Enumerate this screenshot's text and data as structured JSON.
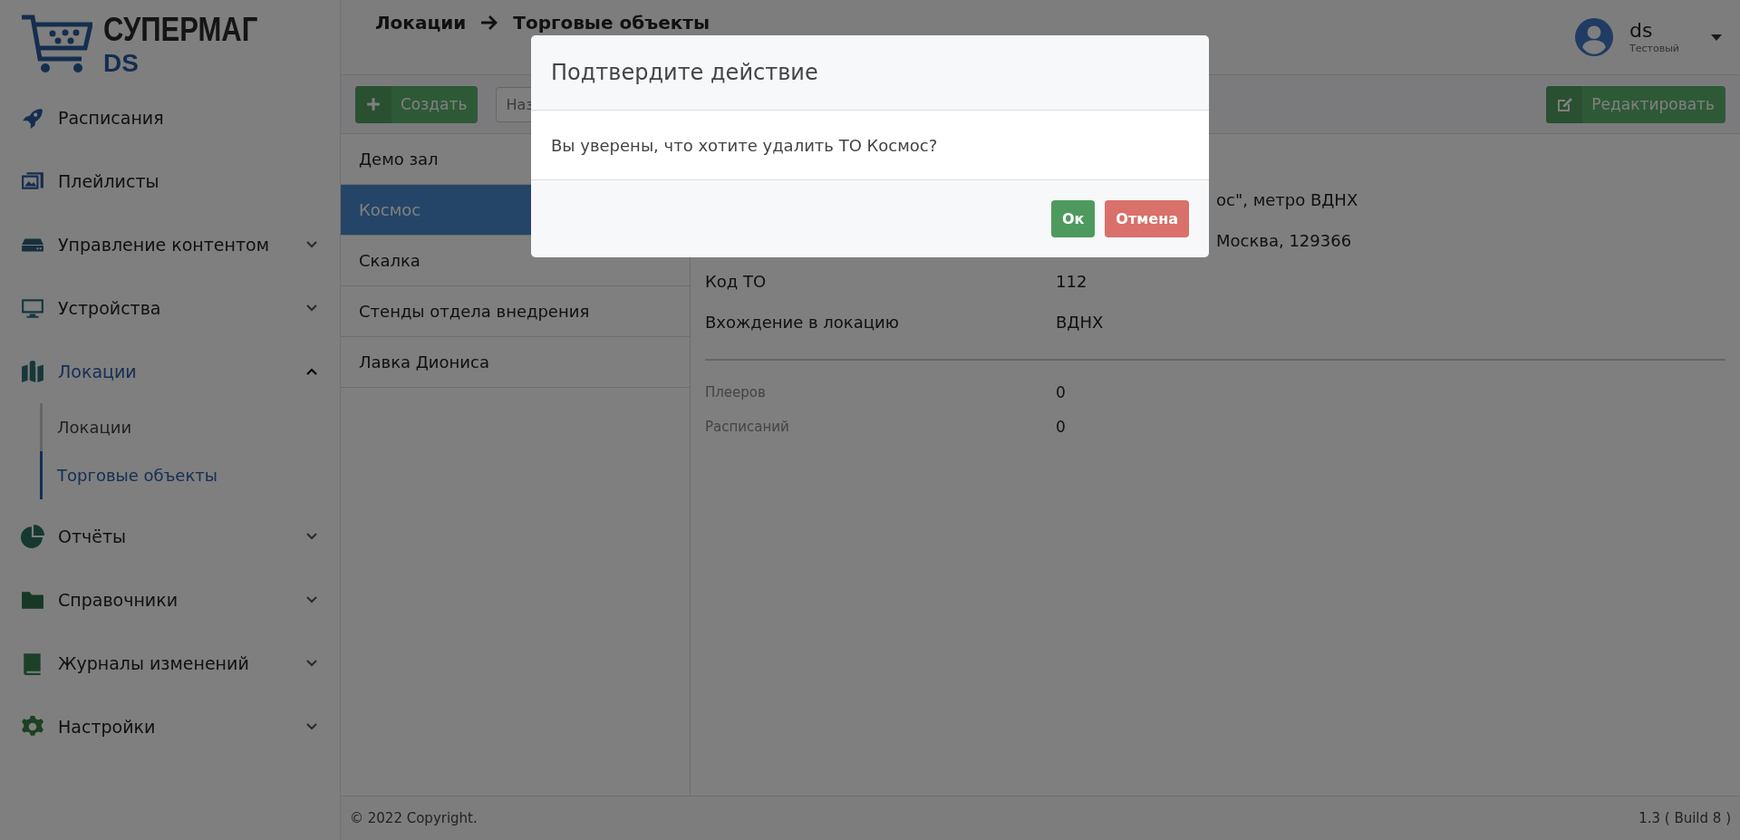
{
  "logo": {
    "name": "СУПЕРМАГ",
    "sub": "DS"
  },
  "sidebar": {
    "items": [
      {
        "label": "Расписания",
        "selected": false
      },
      {
        "label": "Плейлисты",
        "selected": false
      },
      {
        "label": "Управление контентом",
        "expanded": false,
        "selected": false
      },
      {
        "label": "Устройства",
        "expanded": false,
        "selected": false
      },
      {
        "label": "Локации",
        "expanded": true,
        "selected": true,
        "children": [
          {
            "label": "Локации",
            "selected": false
          },
          {
            "label": "Торговые объекты",
            "selected": true
          }
        ]
      },
      {
        "label": "Отчёты",
        "expanded": false,
        "selected": false
      },
      {
        "label": "Справочники",
        "expanded": false,
        "selected": false
      },
      {
        "label": "Журналы изменений",
        "expanded": false,
        "selected": false
      },
      {
        "label": "Настройки",
        "expanded": false,
        "selected": false
      }
    ]
  },
  "header": {
    "breadcrumb": [
      "Локации",
      "Торговые объекты"
    ],
    "user": {
      "name": "ds",
      "role": "Тестовый"
    }
  },
  "toolbar": {
    "create_button": "Создать",
    "search": {
      "placeholder": "Наз"
    },
    "edit_button": "Редактировать"
  },
  "list": {
    "items": [
      {
        "label": "Демо зал",
        "selected": false
      },
      {
        "label": "Космос",
        "selected": true
      },
      {
        "label": "Скалка",
        "selected": false
      },
      {
        "label": "Стенды отдела внедрения",
        "selected": false
      },
      {
        "label": "Лавка Диониса",
        "selected": false
      }
    ]
  },
  "details": {
    "rows": [
      {
        "kind": "covered",
        "value": "ос\", метро ВДНХ"
      },
      {
        "kind": "covered",
        "value": "Москва, 129366"
      },
      {
        "kind": "main",
        "label": "Код ТО",
        "value": "112"
      },
      {
        "kind": "main",
        "label": "Вхождение в локацию",
        "value": "ВДНХ"
      },
      {
        "kind": "divider"
      },
      {
        "kind": "stat",
        "label": "Плееров",
        "value": "0"
      },
      {
        "kind": "stat",
        "label": "Расписаний",
        "value": "0"
      }
    ]
  },
  "footer": {
    "copyright": "© 2022 Copyright.",
    "version": "1.3 ( Build 8 )"
  },
  "modal": {
    "title": "Подтвердите действие",
    "message": "Вы уверены, что хотите удалить ТО Космос?",
    "ok_button": "Ок",
    "cancel_button": "Отмена"
  }
}
